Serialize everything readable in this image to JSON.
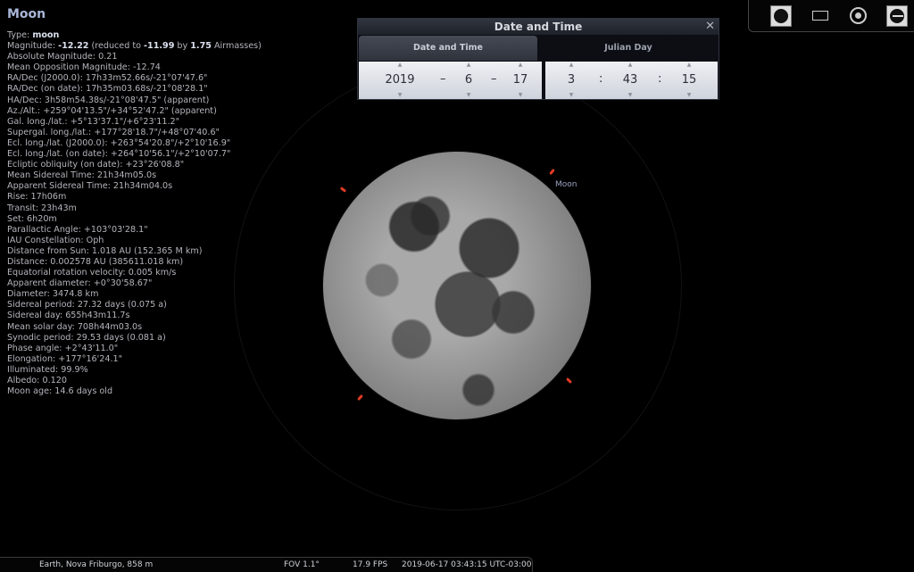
{
  "info": {
    "title": "Moon",
    "lines": [
      {
        "label": "Type: ",
        "value": "moon",
        "bold_value": true
      },
      {
        "label": "Magnitude: ",
        "value": "-12.22",
        "bold_value": true,
        "extra": " (reduced to ",
        "v2": "-11.99",
        "extra2": " by ",
        "v3": "1.75",
        "extra3": " Airmasses)"
      },
      {
        "label": "Absolute Magnitude: 0.21"
      },
      {
        "label": "Mean Opposition Magnitude: -12.74"
      },
      {
        "label": "RA/Dec (J2000.0): 17h33m52.66s/-21°07'47.6\""
      },
      {
        "label": "RA/Dec (on date): 17h35m03.68s/-21°08'28.1\""
      },
      {
        "label": "HA/Dec: 3h58m54.38s/-21°08'47.5\" (apparent)"
      },
      {
        "label": "Az./Alt.: +259°04'13.5\"/+34°52'47.2\" (apparent)"
      },
      {
        "label": "Gal. long./lat.: +5°13'37.1\"/+6°23'11.2\""
      },
      {
        "label": "Supergal. long./lat.: +177°28'18.7\"/+48°07'40.6\""
      },
      {
        "label": "Ecl. long./lat. (J2000.0): +263°54'20.8\"/+2°10'16.9\""
      },
      {
        "label": "Ecl. long./lat. (on date): +264°10'56.1\"/+2°10'07.7\""
      },
      {
        "label": "Ecliptic obliquity (on date): +23°26'08.8\""
      },
      {
        "label": "Mean Sidereal Time: 21h34m05.0s"
      },
      {
        "label": "Apparent Sidereal Time: 21h34m04.0s"
      },
      {
        "label": "Rise: 17h06m"
      },
      {
        "label": "Transit: 23h43m"
      },
      {
        "label": "Set: 6h20m"
      },
      {
        "label": "Parallactic Angle: +103°03'28.1\""
      },
      {
        "label": "IAU Constellation: Oph"
      },
      {
        "label": "Distance from Sun: 1.018 AU (152.365 M km)"
      },
      {
        "label": "Distance: 0.002578 AU (385611.018 km)"
      },
      {
        "label": "Equatorial rotation velocity: 0.005 km/s"
      },
      {
        "label": "Apparent diameter: +0°30'58.67\""
      },
      {
        "label": "Diameter: 3474.8 km"
      },
      {
        "label": "Sidereal period: 27.32 days (0.075 a)"
      },
      {
        "label": "Sidereal day: 655h43m11.7s"
      },
      {
        "label": "Mean solar day: 708h44m03.0s"
      },
      {
        "label": "Synodic period: 29.53 days (0.081 a)"
      },
      {
        "label": "Phase angle: +2°43'11.0\""
      },
      {
        "label": "Elongation: +177°16'24.1\""
      },
      {
        "label": "Illuminated: 99.9%"
      },
      {
        "label": "Albedo: 0.120"
      },
      {
        "label": "Moon age: 14.6 days old"
      }
    ]
  },
  "sky": {
    "object_label": "Moon"
  },
  "dialog": {
    "title": "Date and Time",
    "close": "✕",
    "tabs": [
      "Date and Time",
      "Julian Day"
    ],
    "date": {
      "year": "2019",
      "month": "6",
      "day": "17",
      "sep": "–"
    },
    "time": {
      "hour": "3",
      "minute": "43",
      "second": "15",
      "sep": ":"
    }
  },
  "bottom_bar": {
    "location": "Earth, Nova Friburgo, 858 m",
    "fov": "FOV 1.1°",
    "fps": "17.9 FPS",
    "datetime": "2019-06-17 03:43:15 UTC-03:00"
  },
  "toolbar_icons": [
    "lunar-disk-icon",
    "ocular-frame-icon",
    "telrad-target-icon",
    "sensor-icon"
  ]
}
